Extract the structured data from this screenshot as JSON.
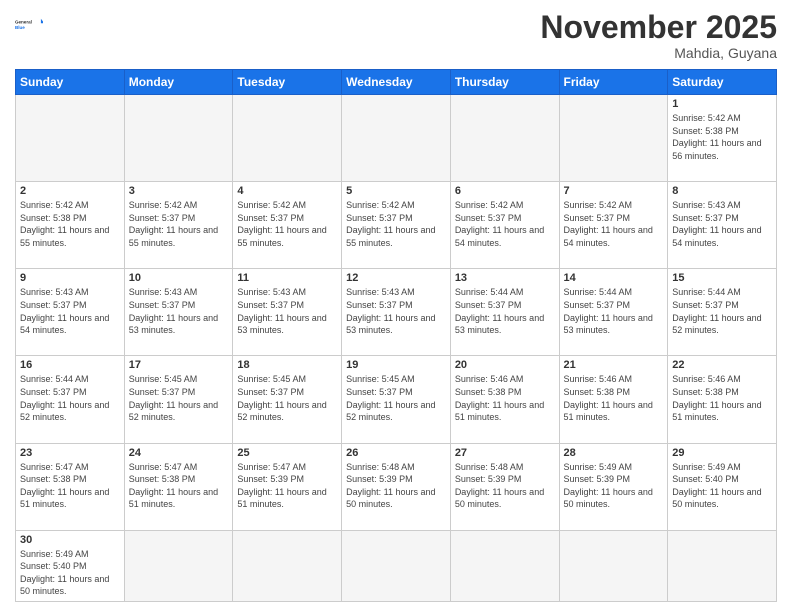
{
  "header": {
    "logo_general": "General",
    "logo_blue": "Blue",
    "month": "November 2025",
    "location": "Mahdia, Guyana"
  },
  "weekdays": [
    "Sunday",
    "Monday",
    "Tuesday",
    "Wednesday",
    "Thursday",
    "Friday",
    "Saturday"
  ],
  "weeks": [
    [
      {
        "day": null,
        "empty": true
      },
      {
        "day": null,
        "empty": true
      },
      {
        "day": null,
        "empty": true
      },
      {
        "day": null,
        "empty": true
      },
      {
        "day": null,
        "empty": true
      },
      {
        "day": null,
        "empty": true
      },
      {
        "day": "1",
        "sunrise": "Sunrise: 5:42 AM",
        "sunset": "Sunset: 5:38 PM",
        "daylight": "Daylight: 11 hours and 56 minutes."
      }
    ],
    [
      {
        "day": "2",
        "sunrise": "Sunrise: 5:42 AM",
        "sunset": "Sunset: 5:38 PM",
        "daylight": "Daylight: 11 hours and 55 minutes."
      },
      {
        "day": "3",
        "sunrise": "Sunrise: 5:42 AM",
        "sunset": "Sunset: 5:37 PM",
        "daylight": "Daylight: 11 hours and 55 minutes."
      },
      {
        "day": "4",
        "sunrise": "Sunrise: 5:42 AM",
        "sunset": "Sunset: 5:37 PM",
        "daylight": "Daylight: 11 hours and 55 minutes."
      },
      {
        "day": "5",
        "sunrise": "Sunrise: 5:42 AM",
        "sunset": "Sunset: 5:37 PM",
        "daylight": "Daylight: 11 hours and 55 minutes."
      },
      {
        "day": "6",
        "sunrise": "Sunrise: 5:42 AM",
        "sunset": "Sunset: 5:37 PM",
        "daylight": "Daylight: 11 hours and 54 minutes."
      },
      {
        "day": "7",
        "sunrise": "Sunrise: 5:42 AM",
        "sunset": "Sunset: 5:37 PM",
        "daylight": "Daylight: 11 hours and 54 minutes."
      },
      {
        "day": "8",
        "sunrise": "Sunrise: 5:43 AM",
        "sunset": "Sunset: 5:37 PM",
        "daylight": "Daylight: 11 hours and 54 minutes."
      }
    ],
    [
      {
        "day": "9",
        "sunrise": "Sunrise: 5:43 AM",
        "sunset": "Sunset: 5:37 PM",
        "daylight": "Daylight: 11 hours and 54 minutes."
      },
      {
        "day": "10",
        "sunrise": "Sunrise: 5:43 AM",
        "sunset": "Sunset: 5:37 PM",
        "daylight": "Daylight: 11 hours and 53 minutes."
      },
      {
        "day": "11",
        "sunrise": "Sunrise: 5:43 AM",
        "sunset": "Sunset: 5:37 PM",
        "daylight": "Daylight: 11 hours and 53 minutes."
      },
      {
        "day": "12",
        "sunrise": "Sunrise: 5:43 AM",
        "sunset": "Sunset: 5:37 PM",
        "daylight": "Daylight: 11 hours and 53 minutes."
      },
      {
        "day": "13",
        "sunrise": "Sunrise: 5:44 AM",
        "sunset": "Sunset: 5:37 PM",
        "daylight": "Daylight: 11 hours and 53 minutes."
      },
      {
        "day": "14",
        "sunrise": "Sunrise: 5:44 AM",
        "sunset": "Sunset: 5:37 PM",
        "daylight": "Daylight: 11 hours and 53 minutes."
      },
      {
        "day": "15",
        "sunrise": "Sunrise: 5:44 AM",
        "sunset": "Sunset: 5:37 PM",
        "daylight": "Daylight: 11 hours and 52 minutes."
      }
    ],
    [
      {
        "day": "16",
        "sunrise": "Sunrise: 5:44 AM",
        "sunset": "Sunset: 5:37 PM",
        "daylight": "Daylight: 11 hours and 52 minutes."
      },
      {
        "day": "17",
        "sunrise": "Sunrise: 5:45 AM",
        "sunset": "Sunset: 5:37 PM",
        "daylight": "Daylight: 11 hours and 52 minutes."
      },
      {
        "day": "18",
        "sunrise": "Sunrise: 5:45 AM",
        "sunset": "Sunset: 5:37 PM",
        "daylight": "Daylight: 11 hours and 52 minutes."
      },
      {
        "day": "19",
        "sunrise": "Sunrise: 5:45 AM",
        "sunset": "Sunset: 5:37 PM",
        "daylight": "Daylight: 11 hours and 52 minutes."
      },
      {
        "day": "20",
        "sunrise": "Sunrise: 5:46 AM",
        "sunset": "Sunset: 5:38 PM",
        "daylight": "Daylight: 11 hours and 51 minutes."
      },
      {
        "day": "21",
        "sunrise": "Sunrise: 5:46 AM",
        "sunset": "Sunset: 5:38 PM",
        "daylight": "Daylight: 11 hours and 51 minutes."
      },
      {
        "day": "22",
        "sunrise": "Sunrise: 5:46 AM",
        "sunset": "Sunset: 5:38 PM",
        "daylight": "Daylight: 11 hours and 51 minutes."
      }
    ],
    [
      {
        "day": "23",
        "sunrise": "Sunrise: 5:47 AM",
        "sunset": "Sunset: 5:38 PM",
        "daylight": "Daylight: 11 hours and 51 minutes."
      },
      {
        "day": "24",
        "sunrise": "Sunrise: 5:47 AM",
        "sunset": "Sunset: 5:38 PM",
        "daylight": "Daylight: 11 hours and 51 minutes."
      },
      {
        "day": "25",
        "sunrise": "Sunrise: 5:47 AM",
        "sunset": "Sunset: 5:39 PM",
        "daylight": "Daylight: 11 hours and 51 minutes."
      },
      {
        "day": "26",
        "sunrise": "Sunrise: 5:48 AM",
        "sunset": "Sunset: 5:39 PM",
        "daylight": "Daylight: 11 hours and 50 minutes."
      },
      {
        "day": "27",
        "sunrise": "Sunrise: 5:48 AM",
        "sunset": "Sunset: 5:39 PM",
        "daylight": "Daylight: 11 hours and 50 minutes."
      },
      {
        "day": "28",
        "sunrise": "Sunrise: 5:49 AM",
        "sunset": "Sunset: 5:39 PM",
        "daylight": "Daylight: 11 hours and 50 minutes."
      },
      {
        "day": "29",
        "sunrise": "Sunrise: 5:49 AM",
        "sunset": "Sunset: 5:40 PM",
        "daylight": "Daylight: 11 hours and 50 minutes."
      }
    ],
    [
      {
        "day": "30",
        "sunrise": "Sunrise: 5:49 AM",
        "sunset": "Sunset: 5:40 PM",
        "daylight": "Daylight: 11 hours and 50 minutes."
      },
      {
        "day": null,
        "empty": true
      },
      {
        "day": null,
        "empty": true
      },
      {
        "day": null,
        "empty": true
      },
      {
        "day": null,
        "empty": true
      },
      {
        "day": null,
        "empty": true
      },
      {
        "day": null,
        "empty": true
      }
    ]
  ]
}
